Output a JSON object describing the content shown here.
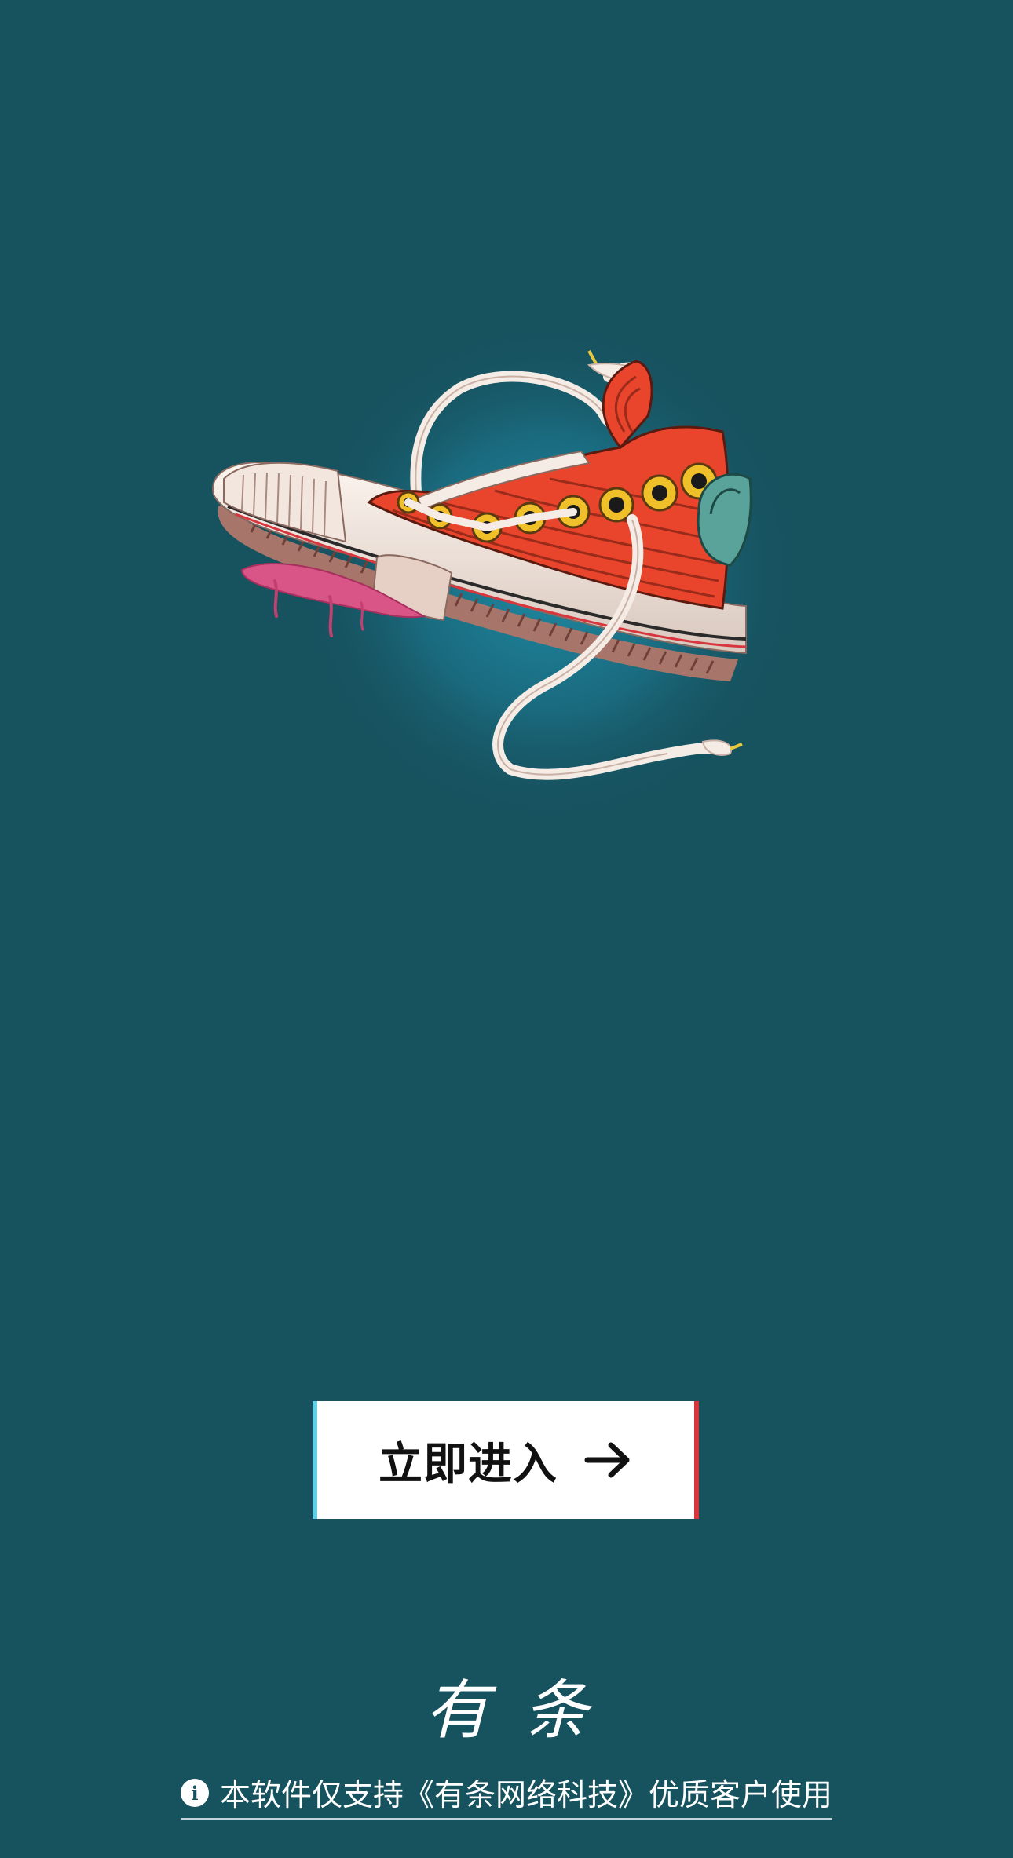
{
  "enter_button": {
    "label": "立即进入",
    "icon": "arrow-right-icon"
  },
  "brand": {
    "name": "有条"
  },
  "notice": {
    "icon": "info-icon",
    "icon_glyph": "i",
    "text": "本软件仅支持《有条网络科技》优质客户使用"
  },
  "illustration": {
    "subject": "red-high-top-sneaker"
  },
  "colors": {
    "background": "#17525f",
    "button_background": "#ffffff",
    "button_edge_left": "#5fd0e8",
    "button_edge_right": "#d8353d",
    "shoe_red": "#e8452c"
  }
}
